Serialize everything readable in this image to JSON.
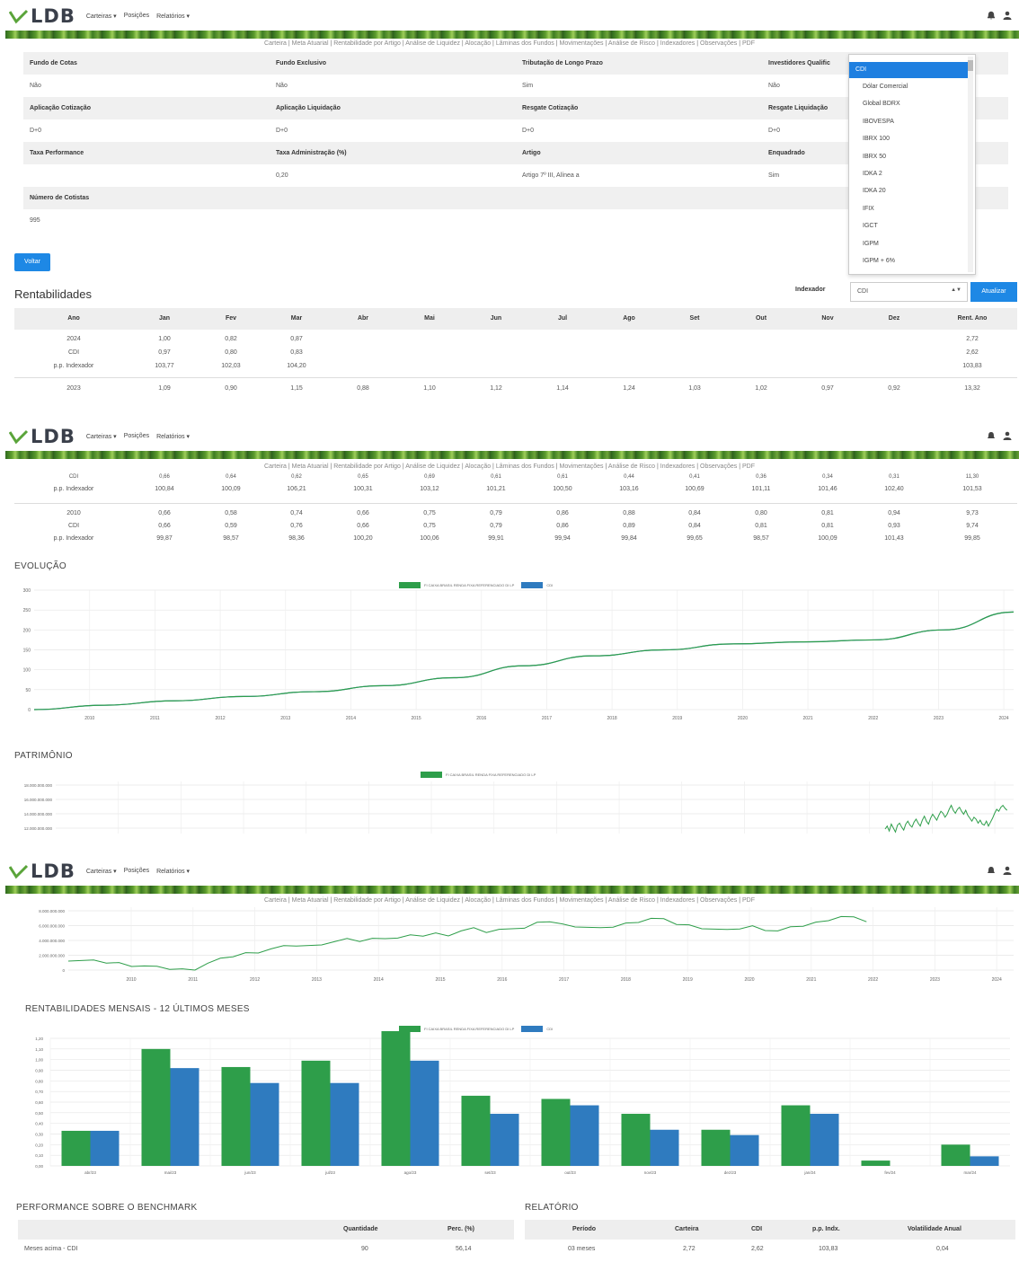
{
  "navbar": {
    "logo_text": "LDB",
    "menu": [
      "Carteiras ▾",
      "Posições",
      "Relatórios ▾"
    ]
  },
  "subnav": [
    "Carteira",
    "Meta Atuarial",
    "Rentabilidade por Artigo",
    "Análise de Liquidez",
    "Alocação",
    "Lâminas dos Fundos",
    "Movimentações",
    "Análise de Risco",
    "Indexadores",
    "Observações",
    "PDF"
  ],
  "fund_info": {
    "rows": [
      {
        "headers": [
          "Fundo de Cotas",
          "Fundo Exclusivo",
          "Tributação de Longo Prazo",
          "Investidores Qualific"
        ],
        "values": [
          "Não",
          "Não",
          "Sim",
          "Não"
        ]
      },
      {
        "headers": [
          "Aplicação Cotização",
          "Aplicação Liquidação",
          "Resgate Cotização",
          "Resgate Liquidação"
        ],
        "values": [
          "D+0",
          "D+0",
          "D+0",
          "D+0"
        ]
      },
      {
        "headers": [
          "Taxa Performance",
          "Taxa Administração (%)",
          "Artigo",
          "Enquadrado"
        ],
        "values": [
          "",
          "0,20",
          "Artigo 7º III, Alínea a",
          "Sim"
        ]
      },
      {
        "headers": [
          "Número de Cotistas",
          "",
          "",
          ""
        ],
        "values": [
          "995",
          "",
          "",
          ""
        ]
      }
    ],
    "back_button": "Voltar"
  },
  "index_dropdown": {
    "options": [
      "CDI",
      "Dólar Comercial",
      "Global BDRX",
      "IBOVESPA",
      "IBRX 100",
      "IBRX 50",
      "IDKA 2",
      "IDKA 20",
      "IFIX",
      "IGCT",
      "IGPM",
      "IGPM + 6%"
    ],
    "selected": "CDI"
  },
  "rentabilidades": {
    "title": "Rentabilidades",
    "indexador_label": "Indexador",
    "indexador_value": "CDI",
    "update_button": "Atualizar",
    "columns": [
      "Ano",
      "Jan",
      "Fev",
      "Mar",
      "Abr",
      "Mai",
      "Jun",
      "Jul",
      "Ago",
      "Set",
      "Out",
      "Nov",
      "Dez",
      "Rent. Ano"
    ],
    "block_2024": [
      [
        "2024",
        "1,00",
        "0,82",
        "0,87",
        "",
        "",
        "",
        "",
        "",
        "",
        "",
        "",
        "",
        "2,72"
      ],
      [
        "CDI",
        "0,97",
        "0,80",
        "0,83",
        "",
        "",
        "",
        "",
        "",
        "",
        "",
        "",
        "",
        "2,62"
      ],
      [
        "p.p. Indexador",
        "103,77",
        "102,03",
        "104,20",
        "",
        "",
        "",
        "",
        "",
        "",
        "",
        "",
        "",
        "103,83"
      ]
    ],
    "row_2023": [
      "2023",
      "1,09",
      "0,90",
      "1,15",
      "0,88",
      "1,10",
      "1,12",
      "1,14",
      "1,24",
      "1,03",
      "1,02",
      "0,97",
      "0,92",
      "13,32"
    ],
    "block_top_2": [
      [
        "CDI",
        "0,66",
        "0,64",
        "0,62",
        "0,65",
        "0,69",
        "0,61",
        "0,61",
        "0,44",
        "0,41",
        "0,36",
        "0,34",
        "0,31",
        "11,30"
      ],
      [
        "p.p. Indexador",
        "100,84",
        "100,09",
        "106,21",
        "100,31",
        "103,12",
        "101,21",
        "100,50",
        "103,16",
        "100,69",
        "101,11",
        "101,46",
        "102,40",
        "101,53"
      ]
    ],
    "block_2010": [
      [
        "2010",
        "0,66",
        "0,58",
        "0,74",
        "0,66",
        "0,75",
        "0,79",
        "0,86",
        "0,88",
        "0,84",
        "0,80",
        "0,81",
        "0,94",
        "9,73"
      ],
      [
        "CDI",
        "0,66",
        "0,59",
        "0,76",
        "0,66",
        "0,75",
        "0,79",
        "0,86",
        "0,89",
        "0,84",
        "0,81",
        "0,81",
        "0,93",
        "9,74"
      ],
      [
        "p.p. Indexador",
        "99,87",
        "98,57",
        "98,36",
        "100,20",
        "100,06",
        "99,91",
        "99,94",
        "99,84",
        "99,65",
        "98,57",
        "100,09",
        "101,43",
        "99,85"
      ]
    ]
  },
  "evolucao": {
    "title": "EVOLUÇÃO",
    "legend": [
      "FI CAIXA BRASIL RENDA FIXA REFERENCIADO DI LP",
      "CDI"
    ],
    "colors": {
      "fund": "#2e9e4a",
      "cdi": "#2f7bbf"
    },
    "y_ticks": [
      "300",
      "250",
      "200",
      "150",
      "100",
      "50",
      "0"
    ],
    "x_ticks": [
      "2010",
      "2011",
      "2012",
      "2013",
      "2014",
      "2015",
      "2016",
      "2017",
      "2018",
      "2019",
      "2020",
      "2021",
      "2022",
      "2023",
      "2024"
    ]
  },
  "patrimonio": {
    "title": "PATRIMÔNIO",
    "legend": [
      "FI CAIXA BRASIL RENDA FIXA REFERENCIADO DI LP"
    ],
    "y_ticks_top": [
      "18.000.000.000",
      "16.000.000.000",
      "14.000.000.000",
      "12.000.000.000"
    ],
    "y_ticks_bottom": [
      "8.000.000.000",
      "6.000.000.000",
      "4.000.000.000",
      "2.000.000.000",
      "0"
    ],
    "x_ticks": [
      "2010",
      "2011",
      "2012",
      "2013",
      "2014",
      "2015",
      "2016",
      "2017",
      "2018",
      "2019",
      "2020",
      "2021",
      "2022",
      "2023",
      "2024"
    ]
  },
  "mensais": {
    "title": "RENTABILIDADES MENSAIS - 12 ÚLTIMOS MESES",
    "legend": [
      "FI CAIXA BRASIL RENDA FIXA REFERENCIADO DI LP",
      "CDI"
    ],
    "y_ticks": [
      "1,20",
      "1,10",
      "1,00",
      "0,90",
      "0,80",
      "0,70",
      "0,60",
      "0,50",
      "0,40",
      "0,30",
      "0,20",
      "0,10",
      "0,00"
    ]
  },
  "chart_data": [
    {
      "type": "line",
      "title": "EVOLUÇÃO",
      "x": [
        "2010",
        "2011",
        "2012",
        "2013",
        "2014",
        "2015",
        "2016",
        "2017",
        "2018",
        "2019",
        "2020",
        "2021",
        "2022",
        "2023",
        "2024"
      ],
      "series": [
        {
          "name": "FI CAIXA BRASIL RENDA FIXA REFERENCIADO DI LP",
          "values": [
            0,
            11,
            22,
            33,
            45,
            60,
            80,
            110,
            135,
            150,
            165,
            170,
            175,
            200,
            245
          ]
        },
        {
          "name": "CDI",
          "values": [
            0,
            11,
            22,
            33,
            45,
            60,
            80,
            110,
            135,
            150,
            165,
            170,
            175,
            200,
            245
          ]
        }
      ],
      "ylim": [
        0,
        300
      ]
    },
    {
      "type": "bar",
      "title": "RENTABILIDADES MENSAIS - 12 ÚLTIMOS MESES",
      "categories": [
        "abr/23",
        "mai/23",
        "jun/23",
        "jul/23",
        "ago/23",
        "set/23",
        "out/23",
        "nov/23",
        "dez/23",
        "jan/24",
        "fev/24",
        "mar/24"
      ],
      "series": [
        {
          "name": "FI CAIXA BRASIL RENDA FIXA REFERENCIADO DI LP",
          "values": [
            0.33,
            1.1,
            0.93,
            0.99,
            1.27,
            0.66,
            0.63,
            0.49,
            0.34,
            0.57,
            0.05,
            0.2
          ]
        },
        {
          "name": "CDI",
          "values": [
            0.33,
            0.92,
            0.78,
            0.78,
            0.99,
            0.49,
            0.57,
            0.34,
            0.29,
            0.49,
            0.0,
            0.09
          ]
        }
      ],
      "ylim": [
        0,
        1.25
      ]
    }
  ],
  "benchmark": {
    "title": "PERFORMANCE SOBRE O BENCHMARK",
    "columns": [
      "",
      "Quantidade",
      "Perc. (%)"
    ],
    "row": [
      "Meses acima - CDI",
      "90",
      "56,14"
    ]
  },
  "relatorio": {
    "title": "RELATÓRIO",
    "columns": [
      "Período",
      "Carteira",
      "CDI",
      "p.p. Indx.",
      "Volatilidade Anual"
    ],
    "row": [
      "03 meses",
      "2,72",
      "2,62",
      "103,83",
      "0,04"
    ]
  }
}
